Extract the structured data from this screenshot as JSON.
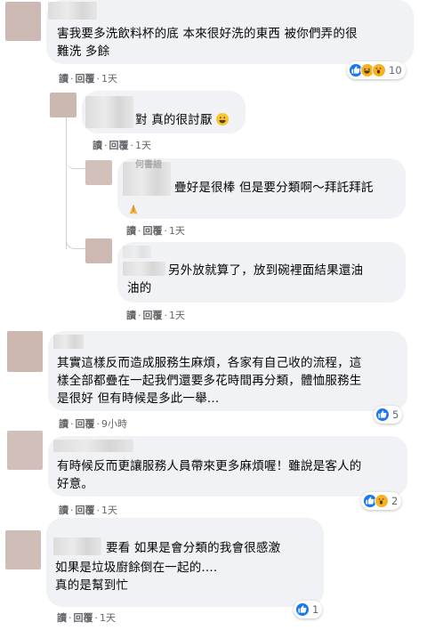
{
  "labels": {
    "reply_action": "讀",
    "reply": "回覆",
    "sep": "·"
  },
  "colors": {
    "like": "#1877f2",
    "haha": "#f7b125",
    "bubble": "#f0f2f5",
    "meta": "#65676b"
  },
  "comments": [
    {
      "text_lines": [
        "害我要多洗飲料杯的底 本來很好洗的東西 被你們弄的很",
        "難洗 多餘"
      ],
      "time": "1天",
      "reactions": [
        "like-icon",
        "haha-icon",
        "wow-icon"
      ],
      "count": "10"
    },
    {
      "text_lines": [
        "對 真的很討厭"
      ],
      "emoji": "grinning-sweat-emoji",
      "time": "1天"
    },
    {
      "author_partial": "何書諳",
      "text_lines": [
        "疊好是很棒 但是要分類啊～拜託拜託",
        ""
      ],
      "emoji": "folded-hands-emoji",
      "time": "1天"
    },
    {
      "text_lines": [
        "另外放就算了，放到碗裡面結果還油",
        "油的"
      ],
      "time": "1天"
    },
    {
      "text_lines": [
        "其實這樣反而造成服務生麻煩，各家有自己收的流程，這",
        "樣全部都疊在一起我們還要多花時間再分類，體恤服務生",
        "是很好 但有時候是多此一舉..."
      ],
      "time": "9小時",
      "reactions": [
        "like-icon"
      ],
      "count": "5"
    },
    {
      "text_lines": [
        "有時候反而更讓服務人員帶來更多麻煩喔！雖說是客人的",
        "好意。"
      ],
      "time": "1天",
      "reactions": [
        "like-icon",
        "wow-icon"
      ],
      "count": "2"
    },
    {
      "text_lines": [
        "要看 如果是會分類的我會很感激",
        "如果是垃圾廚餘倒在一起的....",
        "真的是幫到忙"
      ],
      "time": "1天",
      "reactions": [
        "like-icon"
      ],
      "count": "1"
    }
  ]
}
